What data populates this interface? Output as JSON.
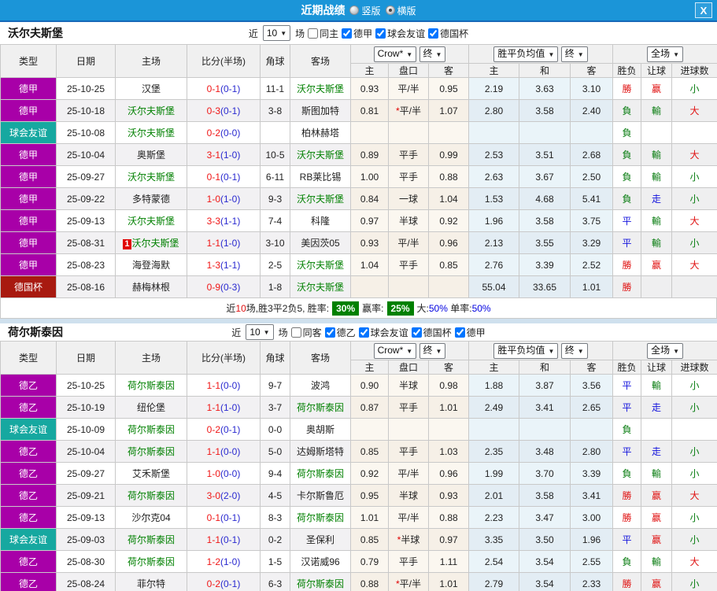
{
  "titlebar": {
    "title": "近期战绩",
    "radio_vertical": "竖版",
    "radio_horizontal": "横版",
    "checked_layout": "横版",
    "close": "X"
  },
  "table_header": {
    "type": "类型",
    "date": "日期",
    "home": "主场",
    "score": "比分(半场)",
    "corner": "角球",
    "away": "客场",
    "odds_dropdown": "Crow*",
    "odds_time_dropdown": "终",
    "odds_home": "主",
    "odds_handicap": "盘口",
    "odds_away": "客",
    "avg_dropdown": "胜平负均值",
    "avg_time_dropdown": "终",
    "avg_home": "主",
    "avg_draw": "和",
    "avg_away": "客",
    "scope_dropdown": "全场",
    "result": "胜负",
    "handicap_result": "让球",
    "goals": "进球数"
  },
  "colors": {
    "type_bg": {
      "德甲": "#a800a8",
      "德乙": "#a800a8",
      "球会友谊": "#16a8a0",
      "德国杯": "#a81a10"
    },
    "result_class": {
      "勝": "res-red",
      "赢": "res-red",
      "大": "res-red",
      "平": "res-blue",
      "走": "res-blue",
      "負": "res-green",
      "輸": "res-green",
      "小": "res-green"
    },
    "focus_green": "#008000",
    "score_red": "#f01616",
    "halftime_blue": "#2a2ad0",
    "titlebar_blue": "#1b95d8",
    "summary_box_green": "#008000"
  },
  "sections": [
    {
      "team": "沃尔夫斯堡",
      "filters": {
        "near": "近",
        "count": "10",
        "games": "场",
        "checkboxes": [
          {
            "label": "同主",
            "checked": false
          },
          {
            "label": "德甲",
            "checked": true
          },
          {
            "label": "球会友谊",
            "checked": true
          },
          {
            "label": "德国杯",
            "checked": true
          }
        ]
      },
      "rows": [
        {
          "type": "德甲",
          "date": "25-10-25",
          "home": "汉堡",
          "home_focus": false,
          "home_badge": "",
          "score_ft": "0-1",
          "score_ht": "(0-1)",
          "corners": "11-1",
          "away": "沃尔夫斯堡",
          "away_focus": true,
          "odds_home": "0.93",
          "handicap_star": "",
          "handicap": "平/半",
          "odds_away": "0.95",
          "avg_home": "2.19",
          "avg_draw": "3.63",
          "avg_away": "3.10",
          "result": "勝",
          "handicap_result": "赢",
          "goals_result": "小"
        },
        {
          "type": "德甲",
          "date": "25-10-18",
          "home": "沃尔夫斯堡",
          "home_focus": true,
          "home_badge": "",
          "score_ft": "0-3",
          "score_ht": "(0-1)",
          "corners": "3-8",
          "away": "斯图加特",
          "away_focus": false,
          "odds_home": "0.81",
          "handicap_star": "*",
          "handicap": "平/半",
          "odds_away": "1.07",
          "avg_home": "2.80",
          "avg_draw": "3.58",
          "avg_away": "2.40",
          "result": "負",
          "handicap_result": "輸",
          "goals_result": "大"
        },
        {
          "type": "球会友谊",
          "date": "25-10-08",
          "home": "沃尔夫斯堡",
          "home_focus": true,
          "home_badge": "",
          "score_ft": "0-2",
          "score_ht": "(0-0)",
          "corners": "",
          "away": "柏林赫塔",
          "away_focus": false,
          "odds_home": "",
          "handicap_star": "",
          "handicap": "",
          "odds_away": "",
          "avg_home": "",
          "avg_draw": "",
          "avg_away": "",
          "result": "負",
          "handicap_result": "",
          "goals_result": ""
        },
        {
          "type": "德甲",
          "date": "25-10-04",
          "home": "奥斯堡",
          "home_focus": false,
          "home_badge": "",
          "score_ft": "3-1",
          "score_ht": "(1-0)",
          "corners": "10-5",
          "away": "沃尔夫斯堡",
          "away_focus": true,
          "odds_home": "0.89",
          "handicap_star": "",
          "handicap": "平手",
          "odds_away": "0.99",
          "avg_home": "2.53",
          "avg_draw": "3.51",
          "avg_away": "2.68",
          "result": "負",
          "handicap_result": "輸",
          "goals_result": "大"
        },
        {
          "type": "德甲",
          "date": "25-09-27",
          "home": "沃尔夫斯堡",
          "home_focus": true,
          "home_badge": "",
          "score_ft": "0-1",
          "score_ht": "(0-1)",
          "corners": "6-11",
          "away": "RB莱比锡",
          "away_focus": false,
          "odds_home": "1.00",
          "handicap_star": "",
          "handicap": "平手",
          "odds_away": "0.88",
          "avg_home": "2.63",
          "avg_draw": "3.67",
          "avg_away": "2.50",
          "result": "負",
          "handicap_result": "輸",
          "goals_result": "小"
        },
        {
          "type": "德甲",
          "date": "25-09-22",
          "home": "多特蒙德",
          "home_focus": false,
          "home_badge": "",
          "score_ft": "1-0",
          "score_ht": "(1-0)",
          "corners": "9-3",
          "away": "沃尔夫斯堡",
          "away_focus": true,
          "odds_home": "0.84",
          "handicap_star": "",
          "handicap": "一球",
          "odds_away": "1.04",
          "avg_home": "1.53",
          "avg_draw": "4.68",
          "avg_away": "5.41",
          "result": "負",
          "handicap_result": "走",
          "goals_result": "小"
        },
        {
          "type": "德甲",
          "date": "25-09-13",
          "home": "沃尔夫斯堡",
          "home_focus": true,
          "home_badge": "",
          "score_ft": "3-3",
          "score_ht": "(1-1)",
          "corners": "7-4",
          "away": "科隆",
          "away_focus": false,
          "odds_home": "0.97",
          "handicap_star": "",
          "handicap": "半球",
          "odds_away": "0.92",
          "avg_home": "1.96",
          "avg_draw": "3.58",
          "avg_away": "3.75",
          "result": "平",
          "handicap_result": "輸",
          "goals_result": "大"
        },
        {
          "type": "德甲",
          "date": "25-08-31",
          "home": "沃尔夫斯堡",
          "home_focus": true,
          "home_badge": "1",
          "score_ft": "1-1",
          "score_ht": "(1-0)",
          "corners": "3-10",
          "away": "美因茨05",
          "away_focus": false,
          "odds_home": "0.93",
          "handicap_star": "",
          "handicap": "平/半",
          "odds_away": "0.96",
          "avg_home": "2.13",
          "avg_draw": "3.55",
          "avg_away": "3.29",
          "result": "平",
          "handicap_result": "輸",
          "goals_result": "小"
        },
        {
          "type": "德甲",
          "date": "25-08-23",
          "home": "海登海默",
          "home_focus": false,
          "home_badge": "",
          "score_ft": "1-3",
          "score_ht": "(1-1)",
          "corners": "2-5",
          "away": "沃尔夫斯堡",
          "away_focus": true,
          "odds_home": "1.04",
          "handicap_star": "",
          "handicap": "平手",
          "odds_away": "0.85",
          "avg_home": "2.76",
          "avg_draw": "3.39",
          "avg_away": "2.52",
          "result": "勝",
          "handicap_result": "赢",
          "goals_result": "大"
        },
        {
          "type": "德国杯",
          "date": "25-08-16",
          "home": "赫梅林根",
          "home_focus": false,
          "home_badge": "",
          "score_ft": "0-9",
          "score_ht": "(0-3)",
          "corners": "1-8",
          "away": "沃尔夫斯堡",
          "away_focus": true,
          "odds_home": "",
          "handicap_star": "",
          "handicap": "",
          "odds_away": "",
          "avg_home": "55.04",
          "avg_draw": "33.65",
          "avg_away": "1.01",
          "result": "勝",
          "handicap_result": "",
          "goals_result": ""
        }
      ],
      "summary": [
        {
          "text": "近",
          "style": "plain"
        },
        {
          "text": "10",
          "style": "red"
        },
        {
          "text": "场,胜3平2负5, 胜率:",
          "style": "plain"
        },
        {
          "text": "30%",
          "style": "greenbox"
        },
        {
          "text": "赢率:",
          "style": "plain"
        },
        {
          "text": "25%",
          "style": "greenbox"
        },
        {
          "text": "大:",
          "style": "plain"
        },
        {
          "text": "50%",
          "style": "blue"
        },
        {
          "text": " 单率:",
          "style": "plain"
        },
        {
          "text": "50%",
          "style": "blue"
        }
      ]
    },
    {
      "team": "荷尔斯泰因",
      "filters": {
        "near": "近",
        "count": "10",
        "games": "场",
        "checkboxes": [
          {
            "label": "同客",
            "checked": false
          },
          {
            "label": "德乙",
            "checked": true
          },
          {
            "label": "球会友谊",
            "checked": true
          },
          {
            "label": "德国杯",
            "checked": true
          },
          {
            "label": "德甲",
            "checked": true
          }
        ]
      },
      "rows": [
        {
          "type": "德乙",
          "date": "25-10-25",
          "home": "荷尔斯泰因",
          "home_focus": true,
          "home_badge": "",
          "score_ft": "1-1",
          "score_ht": "(0-0)",
          "corners": "9-7",
          "away": "波鸿",
          "away_focus": false,
          "odds_home": "0.90",
          "handicap_star": "",
          "handicap": "半球",
          "odds_away": "0.98",
          "avg_home": "1.88",
          "avg_draw": "3.87",
          "avg_away": "3.56",
          "result": "平",
          "handicap_result": "輸",
          "goals_result": "小"
        },
        {
          "type": "德乙",
          "date": "25-10-19",
          "home": "纽伦堡",
          "home_focus": false,
          "home_badge": "",
          "score_ft": "1-1",
          "score_ht": "(1-0)",
          "corners": "3-7",
          "away": "荷尔斯泰因",
          "away_focus": true,
          "odds_home": "0.87",
          "handicap_star": "",
          "handicap": "平手",
          "odds_away": "1.01",
          "avg_home": "2.49",
          "avg_draw": "3.41",
          "avg_away": "2.65",
          "result": "平",
          "handicap_result": "走",
          "goals_result": "小"
        },
        {
          "type": "球会友谊",
          "date": "25-10-09",
          "home": "荷尔斯泰因",
          "home_focus": true,
          "home_badge": "",
          "score_ft": "0-2",
          "score_ht": "(0-1)",
          "corners": "0-0",
          "away": "奥胡斯",
          "away_focus": false,
          "odds_home": "",
          "handicap_star": "",
          "handicap": "",
          "odds_away": "",
          "avg_home": "",
          "avg_draw": "",
          "avg_away": "",
          "result": "負",
          "handicap_result": "",
          "goals_result": ""
        },
        {
          "type": "德乙",
          "date": "25-10-04",
          "home": "荷尔斯泰因",
          "home_focus": true,
          "home_badge": "",
          "score_ft": "1-1",
          "score_ht": "(0-0)",
          "corners": "5-0",
          "away": "达姆斯塔特",
          "away_focus": false,
          "odds_home": "0.85",
          "handicap_star": "",
          "handicap": "平手",
          "odds_away": "1.03",
          "avg_home": "2.35",
          "avg_draw": "3.48",
          "avg_away": "2.80",
          "result": "平",
          "handicap_result": "走",
          "goals_result": "小"
        },
        {
          "type": "德乙",
          "date": "25-09-27",
          "home": "艾禾斯堡",
          "home_focus": false,
          "home_badge": "",
          "score_ft": "1-0",
          "score_ht": "(0-0)",
          "corners": "9-4",
          "away": "荷尔斯泰因",
          "away_focus": true,
          "odds_home": "0.92",
          "handicap_star": "",
          "handicap": "平/半",
          "odds_away": "0.96",
          "avg_home": "1.99",
          "avg_draw": "3.70",
          "avg_away": "3.39",
          "result": "負",
          "handicap_result": "輸",
          "goals_result": "小"
        },
        {
          "type": "德乙",
          "date": "25-09-21",
          "home": "荷尔斯泰因",
          "home_focus": true,
          "home_badge": "",
          "score_ft": "3-0",
          "score_ht": "(2-0)",
          "corners": "4-5",
          "away": "卡尔斯鲁厄",
          "away_focus": false,
          "odds_home": "0.95",
          "handicap_star": "",
          "handicap": "半球",
          "odds_away": "0.93",
          "avg_home": "2.01",
          "avg_draw": "3.58",
          "avg_away": "3.41",
          "result": "勝",
          "handicap_result": "赢",
          "goals_result": "大"
        },
        {
          "type": "德乙",
          "date": "25-09-13",
          "home": "沙尔克04",
          "home_focus": false,
          "home_badge": "",
          "score_ft": "0-1",
          "score_ht": "(0-1)",
          "corners": "8-3",
          "away": "荷尔斯泰因",
          "away_focus": true,
          "odds_home": "1.01",
          "handicap_star": "",
          "handicap": "平/半",
          "odds_away": "0.88",
          "avg_home": "2.23",
          "avg_draw": "3.47",
          "avg_away": "3.00",
          "result": "勝",
          "handicap_result": "赢",
          "goals_result": "小"
        },
        {
          "type": "球会友谊",
          "date": "25-09-03",
          "home": "荷尔斯泰因",
          "home_focus": true,
          "home_badge": "",
          "score_ft": "1-1",
          "score_ht": "(0-1)",
          "corners": "0-2",
          "away": "圣保利",
          "away_focus": false,
          "odds_home": "0.85",
          "handicap_star": "*",
          "handicap": "半球",
          "odds_away": "0.97",
          "avg_home": "3.35",
          "avg_draw": "3.50",
          "avg_away": "1.96",
          "result": "平",
          "handicap_result": "赢",
          "goals_result": "小"
        },
        {
          "type": "德乙",
          "date": "25-08-30",
          "home": "荷尔斯泰因",
          "home_focus": true,
          "home_badge": "",
          "score_ft": "1-2",
          "score_ht": "(1-0)",
          "corners": "1-5",
          "away": "汉诺威96",
          "away_focus": false,
          "odds_home": "0.79",
          "handicap_star": "",
          "handicap": "平手",
          "odds_away": "1.11",
          "avg_home": "2.54",
          "avg_draw": "3.54",
          "avg_away": "2.55",
          "result": "負",
          "handicap_result": "輸",
          "goals_result": "大"
        },
        {
          "type": "德乙",
          "date": "25-08-24",
          "home": "菲尔特",
          "home_focus": false,
          "home_badge": "",
          "score_ft": "0-2",
          "score_ht": "(0-1)",
          "corners": "6-3",
          "away": "荷尔斯泰因",
          "away_focus": true,
          "odds_home": "0.88",
          "handicap_star": "*",
          "handicap": "平/半",
          "odds_away": "1.01",
          "avg_home": "2.79",
          "avg_draw": "3.54",
          "avg_away": "2.33",
          "result": "勝",
          "handicap_result": "赢",
          "goals_result": "小"
        }
      ],
      "summary": null
    }
  ]
}
